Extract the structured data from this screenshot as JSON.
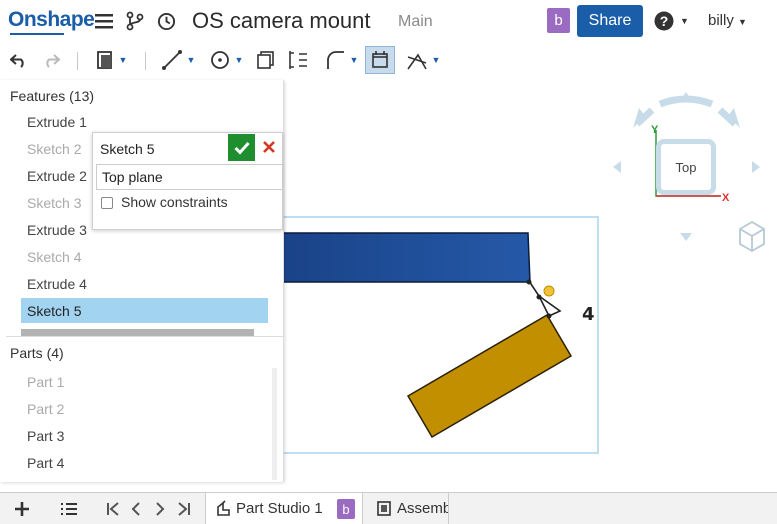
{
  "app": {
    "logo": "Onshape",
    "document_title": "OS camera mount",
    "branch": "Main",
    "user_initial": "b",
    "share_label": "Share",
    "user_name": "billy"
  },
  "feature_panel": {
    "features_header": "Features (13)",
    "features": [
      {
        "label": "Extrude 1",
        "dim": false
      },
      {
        "label": "Sketch 2",
        "dim": true
      },
      {
        "label": "Extrude 2",
        "dim": false
      },
      {
        "label": "Sketch 3",
        "dim": true
      },
      {
        "label": "Extrude 3",
        "dim": false
      },
      {
        "label": "Sketch 4",
        "dim": true
      },
      {
        "label": "Extrude 4",
        "dim": false
      },
      {
        "label": "Sketch 5",
        "dim": false,
        "selected": true
      }
    ],
    "parts_header": "Parts (4)",
    "parts": [
      {
        "label": "Part 1",
        "dim": true
      },
      {
        "label": "Part 2",
        "dim": true
      },
      {
        "label": "Part 3",
        "dim": false
      },
      {
        "label": "Part 4",
        "dim": false
      }
    ]
  },
  "sketch_dialog": {
    "name": "Sketch 5",
    "plane": "Top plane",
    "show_constraints_label": "Show constraints",
    "show_constraints_checked": false
  },
  "viewcube": {
    "face_label": "Top",
    "axis_y": "Y",
    "axis_x": "X"
  },
  "viewport": {
    "sketch_dimension_text": "4"
  },
  "tabs": [
    {
      "label": "Part Studio 1",
      "badge": "b",
      "active": true
    },
    {
      "label": "Assemb",
      "active": false
    }
  ],
  "colors": {
    "brand_blue": "#1a5da8",
    "selection_blue": "#a2d4f2",
    "part_blue": "#1d4a8e",
    "part_gold": "#c28f00",
    "confirm_green": "#1f8e2f",
    "cancel_red": "#d03a22",
    "badge_purple": "#9a6bc0"
  }
}
